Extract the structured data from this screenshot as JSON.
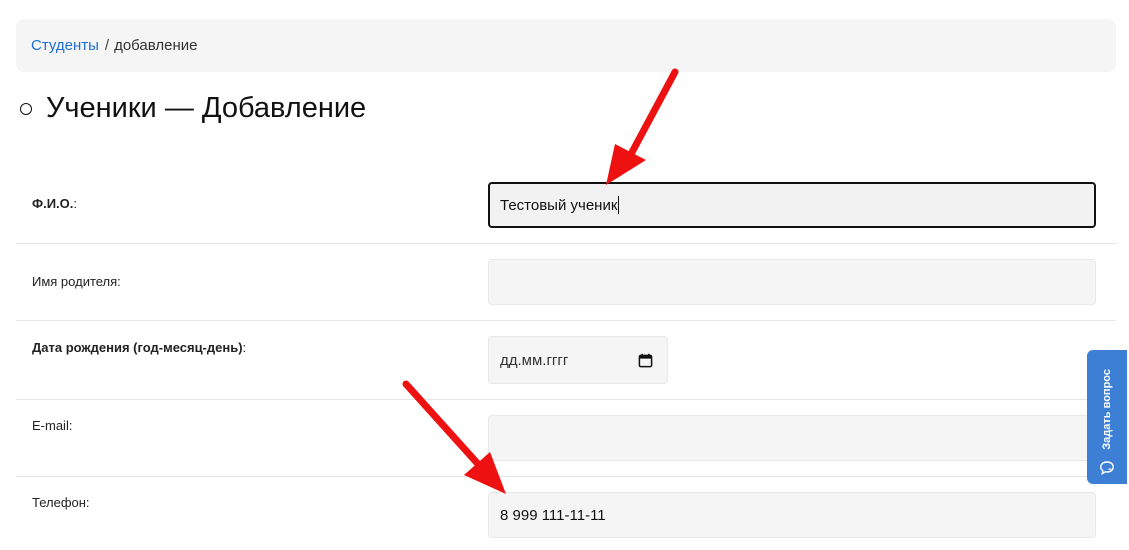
{
  "breadcrumb": {
    "link": "Студенты",
    "separator": "/",
    "current": "добавление"
  },
  "page": {
    "title": "Ученики — Добавление"
  },
  "form": {
    "fio": {
      "label": "Ф.И.О.",
      "suffix": ":",
      "value": "Тестовый ученик"
    },
    "parent": {
      "label": "Имя родителя:",
      "value": ""
    },
    "birth": {
      "label": "Дата рождения (год-месяц-день)",
      "suffix": ":",
      "placeholder": "дд.мм.гггг"
    },
    "email": {
      "label": "E-mail:",
      "value": ""
    },
    "phone": {
      "label": "Телефон:",
      "value": "8 999 111-11-11"
    }
  },
  "widget": {
    "ask_label": "Задать вопрос"
  },
  "icons": {
    "calendar": "calendar-icon",
    "chat": "chat-icon"
  },
  "colors": {
    "link": "#1e6fd6",
    "widget": "#3d7fd4",
    "arrow": "#ee1111"
  }
}
